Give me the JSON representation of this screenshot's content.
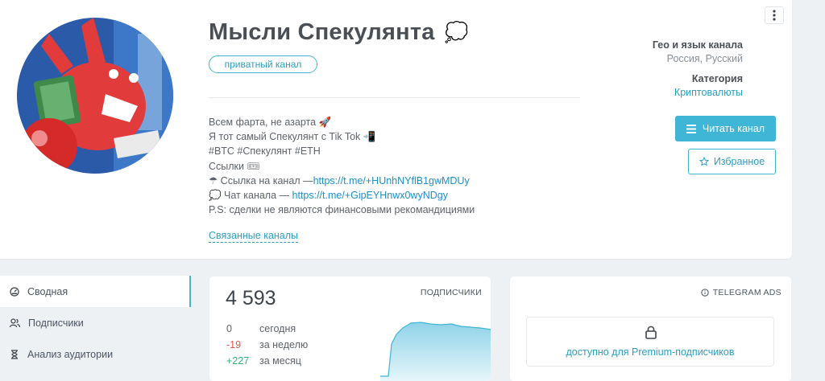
{
  "channel": {
    "title": "Мысли Спекулянта",
    "title_emoji": "💭",
    "badge": "приватный канал",
    "description": [
      {
        "text": "Всем фарта, не азарта 🚀"
      },
      {
        "text": "Я тот самый Спекулянт с Tik Tok 📲"
      },
      {
        "text": "#BTC #Спекулянт #ETH"
      },
      {
        "text": "Ссылки 🎟"
      },
      {
        "text": "☂ Ссылка на канал —",
        "link": "https://t.me/+HUnhNYflB1gwMDUy"
      },
      {
        "text": "💭 Чат канала — ",
        "link": "https://t.me/+GipEYHnwx0wyNDgy"
      },
      {
        "text": "P.S: сделки не являются финансовыми рекомандициями"
      }
    ],
    "related_link": "Связанные каналы"
  },
  "meta": {
    "geo_heading": "Гео и язык канала",
    "geo_value": "Россия, Русский",
    "category_heading": "Категория",
    "category_value": "Криптовалюты"
  },
  "actions": {
    "read": "Читать канал",
    "favorite": "Избранное"
  },
  "sidebar": {
    "items": [
      {
        "label": "Сводная",
        "icon": "dashboard-icon"
      },
      {
        "label": "Подписчики",
        "icon": "users-icon"
      },
      {
        "label": "Анализ аудитории",
        "icon": "hourglass-icon"
      }
    ]
  },
  "stats": {
    "subscribers": "4 593",
    "label": "ПОДПИСЧИКИ",
    "rows": [
      {
        "value": "0",
        "label": "сегодня",
        "color": "#5d636a"
      },
      {
        "value": "-19",
        "label": "за неделю",
        "color": "#e2574c"
      },
      {
        "value": "+227",
        "label": "за месяц",
        "color": "#2fb27a"
      }
    ]
  },
  "ads": {
    "heading": "TELEGRAM ADS",
    "premium_text": "доступно для Premium-подписчиков"
  },
  "colors": {
    "accent": "#3fb6d6",
    "link": "#1e8fc8",
    "negative": "#e2574c",
    "positive": "#2fb27a"
  }
}
